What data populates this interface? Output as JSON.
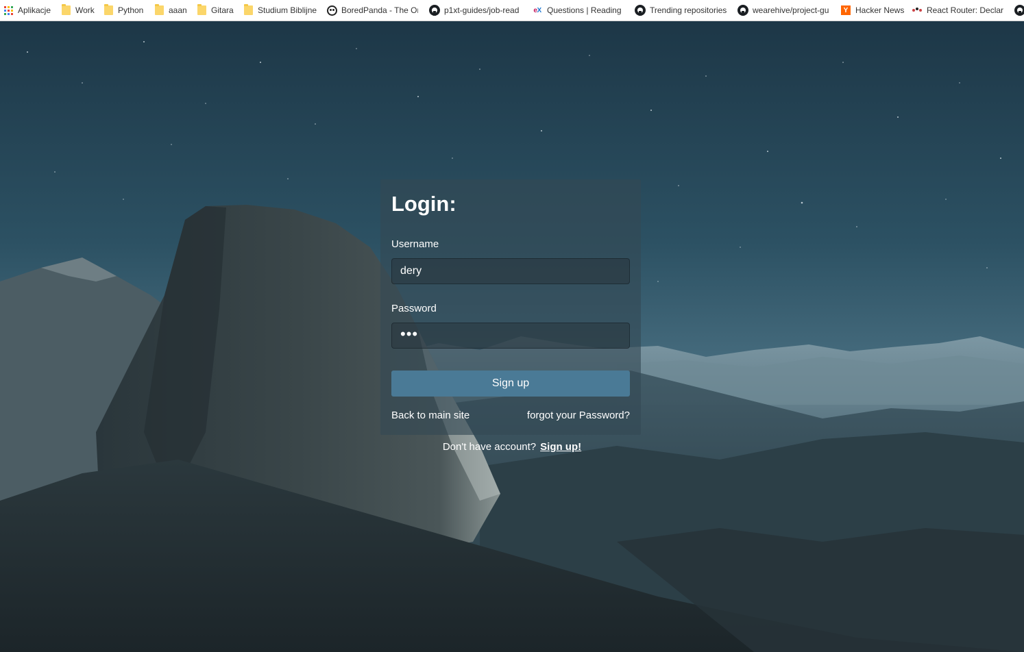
{
  "bookmarks": [
    {
      "label": "Aplikacje",
      "icon": "apps-grid-icon"
    },
    {
      "label": "Work",
      "icon": "folder-icon"
    },
    {
      "label": "Python",
      "icon": "folder-icon"
    },
    {
      "label": "aaan",
      "icon": "folder-icon"
    },
    {
      "label": "Gitara",
      "icon": "folder-icon"
    },
    {
      "label": "Studium Biblijne",
      "icon": "folder-icon"
    },
    {
      "label": "BoredPanda - The Or",
      "icon": "panda-icon"
    },
    {
      "label": "p1xt-guides/job-read",
      "icon": "github-icon"
    },
    {
      "label": "Questions | Reading",
      "icon": "edx-icon"
    },
    {
      "label": "Trending repositories",
      "icon": "github-icon"
    },
    {
      "label": "wearehive/project-gu",
      "icon": "github-icon"
    },
    {
      "label": "Hacker News",
      "icon": "hacker-news-icon"
    },
    {
      "label": "React Router: Declara",
      "icon": "react-router-icon"
    }
  ],
  "login": {
    "title": "Login:",
    "username_label": "Username",
    "username_value": "dery",
    "password_label": "Password",
    "password_value": "•••",
    "signup_button": "Sign up",
    "back_link": "Back to main site",
    "forgot_link": "forgot your Password?",
    "no_account_text": "Don't have account?",
    "signup_link": "Sign up!"
  },
  "colors": {
    "button": "#4a7a96",
    "sky_top": "#1f3a4b",
    "card_bg": "rgba(52,72,84,0.62)"
  }
}
